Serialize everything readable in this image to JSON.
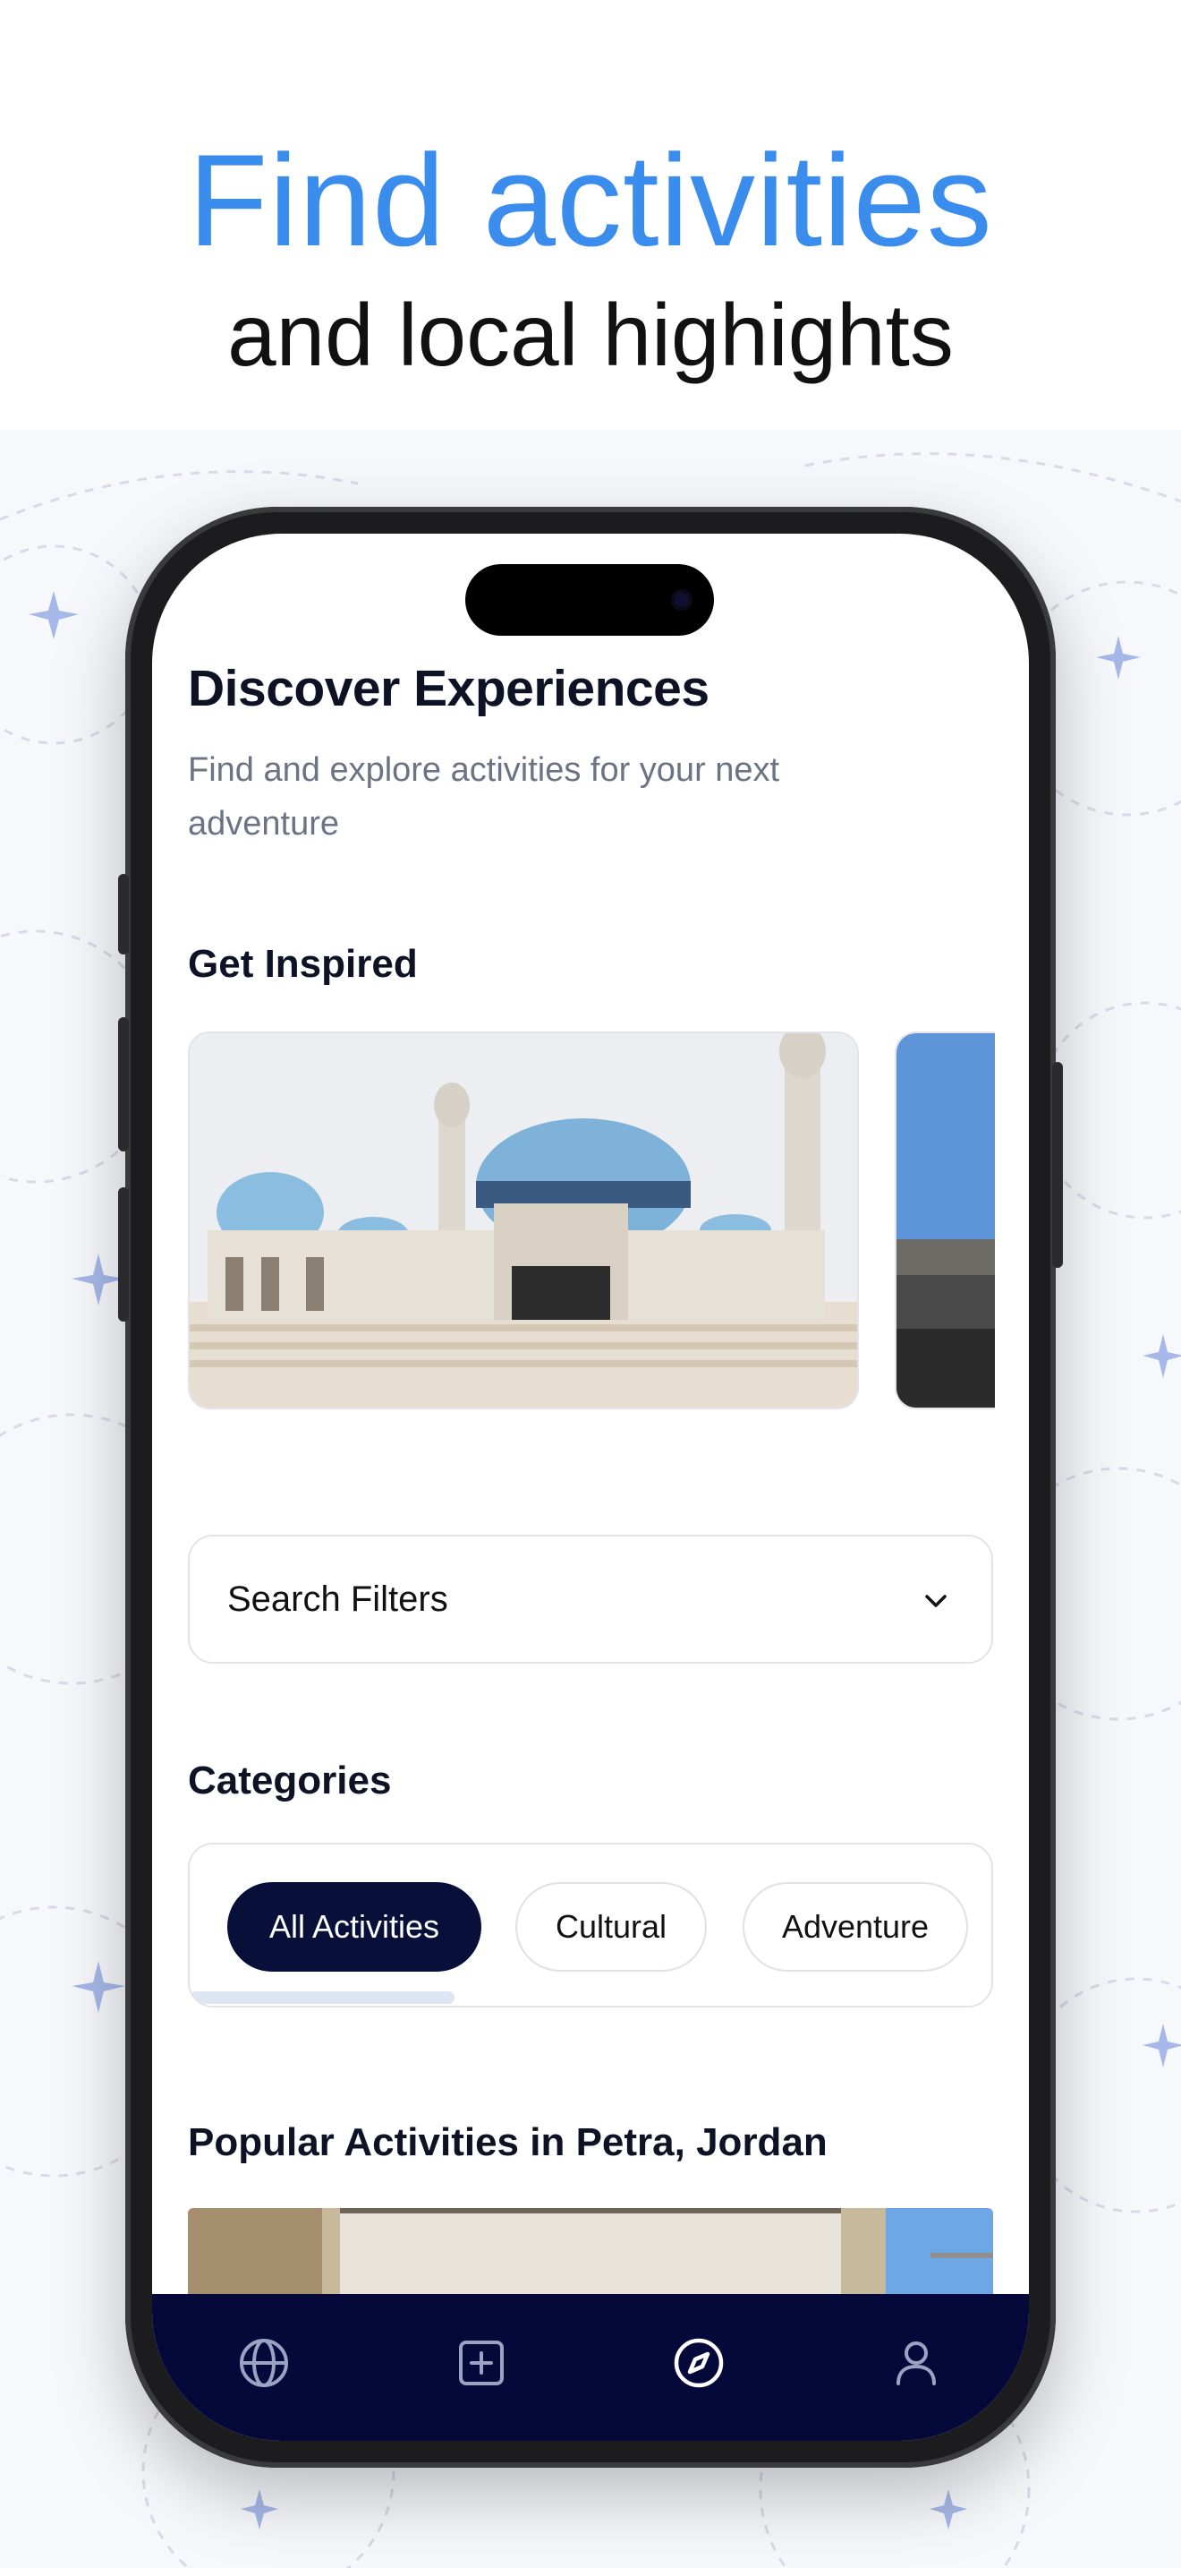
{
  "hero": {
    "title": "Find activities",
    "subtitle": "and local highights"
  },
  "screen": {
    "title": "Discover Experiences",
    "subtitle": "Find and explore activities for your next adventure",
    "inspired_heading": "Get Inspired",
    "filters_label": "Search Filters",
    "categories_heading": "Categories",
    "categories": [
      {
        "label": "All Activities",
        "active": true
      },
      {
        "label": "Cultural",
        "active": false
      },
      {
        "label": "Adventure",
        "active": false
      }
    ],
    "popular_heading": "Popular Activities in Petra, Jordan"
  },
  "tabbar": {
    "items": [
      {
        "icon": "globe-icon"
      },
      {
        "icon": "plus-square-icon"
      },
      {
        "icon": "compass-icon",
        "active": true
      },
      {
        "icon": "user-icon"
      }
    ]
  },
  "colors": {
    "accent": "#3b8ded",
    "navy": "#05093a",
    "muted_text": "#6b7384"
  }
}
